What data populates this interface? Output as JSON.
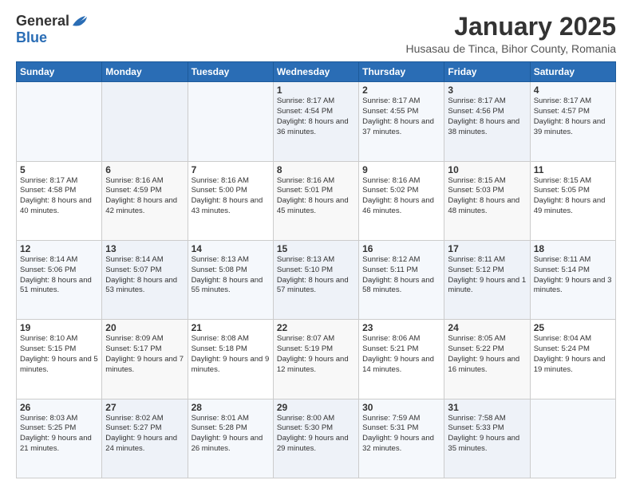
{
  "logo": {
    "general": "General",
    "blue": "Blue"
  },
  "title": "January 2025",
  "location": "Husasau de Tinca, Bihor County, Romania",
  "days_header": [
    "Sunday",
    "Monday",
    "Tuesday",
    "Wednesday",
    "Thursday",
    "Friday",
    "Saturday"
  ],
  "weeks": [
    [
      {
        "day": "",
        "info": ""
      },
      {
        "day": "",
        "info": ""
      },
      {
        "day": "",
        "info": ""
      },
      {
        "day": "1",
        "info": "Sunrise: 8:17 AM\nSunset: 4:54 PM\nDaylight: 8 hours and 36 minutes."
      },
      {
        "day": "2",
        "info": "Sunrise: 8:17 AM\nSunset: 4:55 PM\nDaylight: 8 hours and 37 minutes."
      },
      {
        "day": "3",
        "info": "Sunrise: 8:17 AM\nSunset: 4:56 PM\nDaylight: 8 hours and 38 minutes."
      },
      {
        "day": "4",
        "info": "Sunrise: 8:17 AM\nSunset: 4:57 PM\nDaylight: 8 hours and 39 minutes."
      }
    ],
    [
      {
        "day": "5",
        "info": "Sunrise: 8:17 AM\nSunset: 4:58 PM\nDaylight: 8 hours and 40 minutes."
      },
      {
        "day": "6",
        "info": "Sunrise: 8:16 AM\nSunset: 4:59 PM\nDaylight: 8 hours and 42 minutes."
      },
      {
        "day": "7",
        "info": "Sunrise: 8:16 AM\nSunset: 5:00 PM\nDaylight: 8 hours and 43 minutes."
      },
      {
        "day": "8",
        "info": "Sunrise: 8:16 AM\nSunset: 5:01 PM\nDaylight: 8 hours and 45 minutes."
      },
      {
        "day": "9",
        "info": "Sunrise: 8:16 AM\nSunset: 5:02 PM\nDaylight: 8 hours and 46 minutes."
      },
      {
        "day": "10",
        "info": "Sunrise: 8:15 AM\nSunset: 5:03 PM\nDaylight: 8 hours and 48 minutes."
      },
      {
        "day": "11",
        "info": "Sunrise: 8:15 AM\nSunset: 5:05 PM\nDaylight: 8 hours and 49 minutes."
      }
    ],
    [
      {
        "day": "12",
        "info": "Sunrise: 8:14 AM\nSunset: 5:06 PM\nDaylight: 8 hours and 51 minutes."
      },
      {
        "day": "13",
        "info": "Sunrise: 8:14 AM\nSunset: 5:07 PM\nDaylight: 8 hours and 53 minutes."
      },
      {
        "day": "14",
        "info": "Sunrise: 8:13 AM\nSunset: 5:08 PM\nDaylight: 8 hours and 55 minutes."
      },
      {
        "day": "15",
        "info": "Sunrise: 8:13 AM\nSunset: 5:10 PM\nDaylight: 8 hours and 57 minutes."
      },
      {
        "day": "16",
        "info": "Sunrise: 8:12 AM\nSunset: 5:11 PM\nDaylight: 8 hours and 58 minutes."
      },
      {
        "day": "17",
        "info": "Sunrise: 8:11 AM\nSunset: 5:12 PM\nDaylight: 9 hours and 1 minute."
      },
      {
        "day": "18",
        "info": "Sunrise: 8:11 AM\nSunset: 5:14 PM\nDaylight: 9 hours and 3 minutes."
      }
    ],
    [
      {
        "day": "19",
        "info": "Sunrise: 8:10 AM\nSunset: 5:15 PM\nDaylight: 9 hours and 5 minutes."
      },
      {
        "day": "20",
        "info": "Sunrise: 8:09 AM\nSunset: 5:17 PM\nDaylight: 9 hours and 7 minutes."
      },
      {
        "day": "21",
        "info": "Sunrise: 8:08 AM\nSunset: 5:18 PM\nDaylight: 9 hours and 9 minutes."
      },
      {
        "day": "22",
        "info": "Sunrise: 8:07 AM\nSunset: 5:19 PM\nDaylight: 9 hours and 12 minutes."
      },
      {
        "day": "23",
        "info": "Sunrise: 8:06 AM\nSunset: 5:21 PM\nDaylight: 9 hours and 14 minutes."
      },
      {
        "day": "24",
        "info": "Sunrise: 8:05 AM\nSunset: 5:22 PM\nDaylight: 9 hours and 16 minutes."
      },
      {
        "day": "25",
        "info": "Sunrise: 8:04 AM\nSunset: 5:24 PM\nDaylight: 9 hours and 19 minutes."
      }
    ],
    [
      {
        "day": "26",
        "info": "Sunrise: 8:03 AM\nSunset: 5:25 PM\nDaylight: 9 hours and 21 minutes."
      },
      {
        "day": "27",
        "info": "Sunrise: 8:02 AM\nSunset: 5:27 PM\nDaylight: 9 hours and 24 minutes."
      },
      {
        "day": "28",
        "info": "Sunrise: 8:01 AM\nSunset: 5:28 PM\nDaylight: 9 hours and 26 minutes."
      },
      {
        "day": "29",
        "info": "Sunrise: 8:00 AM\nSunset: 5:30 PM\nDaylight: 9 hours and 29 minutes."
      },
      {
        "day": "30",
        "info": "Sunrise: 7:59 AM\nSunset: 5:31 PM\nDaylight: 9 hours and 32 minutes."
      },
      {
        "day": "31",
        "info": "Sunrise: 7:58 AM\nSunset: 5:33 PM\nDaylight: 9 hours and 35 minutes."
      },
      {
        "day": "",
        "info": ""
      }
    ]
  ]
}
